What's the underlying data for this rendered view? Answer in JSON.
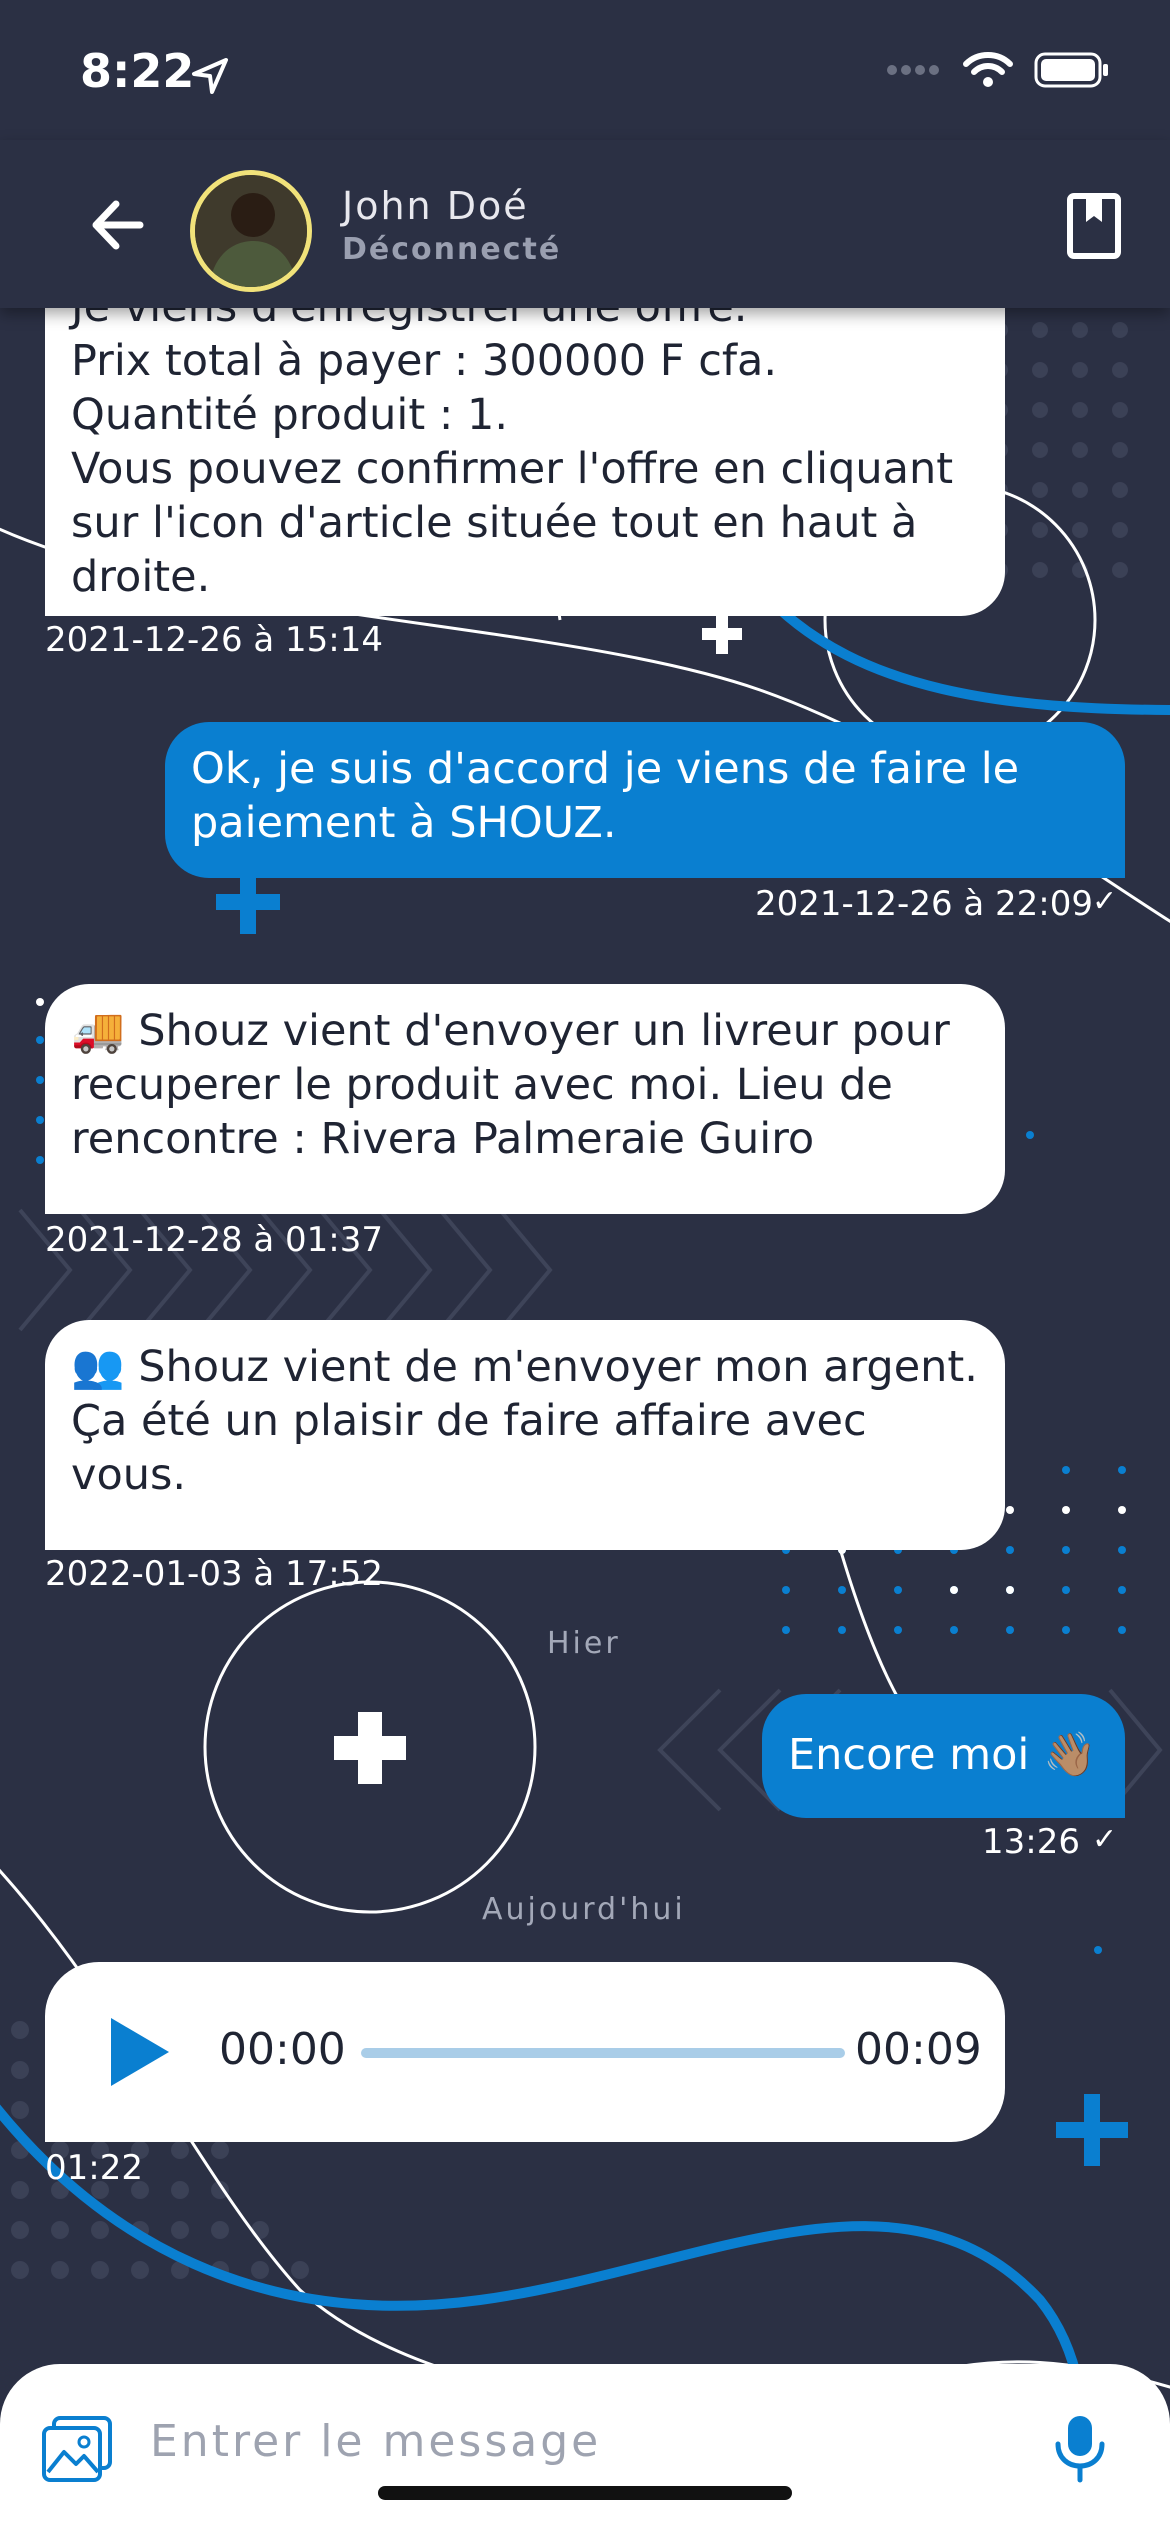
{
  "status_bar": {
    "time": "8:22"
  },
  "header": {
    "name": "John Doé",
    "status": "Déconnecté"
  },
  "messages": [
    {
      "direction": "in",
      "text": "Je viens d'enregistrer une offre.\nPrix total à payer : 300000 F cfa.\nQuantité produit : 1.\n Vous pouvez confirmer l'offre en cliquant sur l'icon d'article située tout en haut à droite.",
      "timestamp": "2021-12-26 à 15:14"
    },
    {
      "direction": "out",
      "text": "Ok, je suis d'accord je viens de faire le paiement à SHOUZ.",
      "timestamp": "2021-12-26 à 22:09"
    },
    {
      "direction": "in",
      "emoji": "🚚",
      "text": " Shouz vient d'envoyer un livreur pour recuperer le produit avec moi. Lieu de rencontre : Rivera Palmeraie Guiro",
      "timestamp": "2021-12-28 à 01:37"
    },
    {
      "direction": "in",
      "emoji": "👥",
      "text": " Shouz vient de m'envoyer mon argent. Ça été un plaisir de faire affaire avec vous.",
      "timestamp": "2022-01-03 à 17:52"
    },
    {
      "direction": "out",
      "text": "Encore moi 👋🏽",
      "timestamp": "13:26"
    }
  ],
  "dividers": {
    "yesterday": "Hier",
    "today": "Aujourd'hui"
  },
  "audio_message": {
    "current_time": "00:00",
    "duration": "00:09",
    "timestamp": "01:22",
    "progress": 0
  },
  "input": {
    "placeholder": "Entrer le message",
    "value": ""
  },
  "colors": {
    "background": "#2b3044",
    "accent": "#0a7fd0",
    "bubble_in": "#ffffff",
    "avatar_ring": "#f1e27a"
  },
  "icons": {
    "back": "arrow-left-icon",
    "book": "bookmark-book-icon",
    "gallery": "gallery-icon",
    "mic": "microphone-icon",
    "play": "play-icon"
  }
}
